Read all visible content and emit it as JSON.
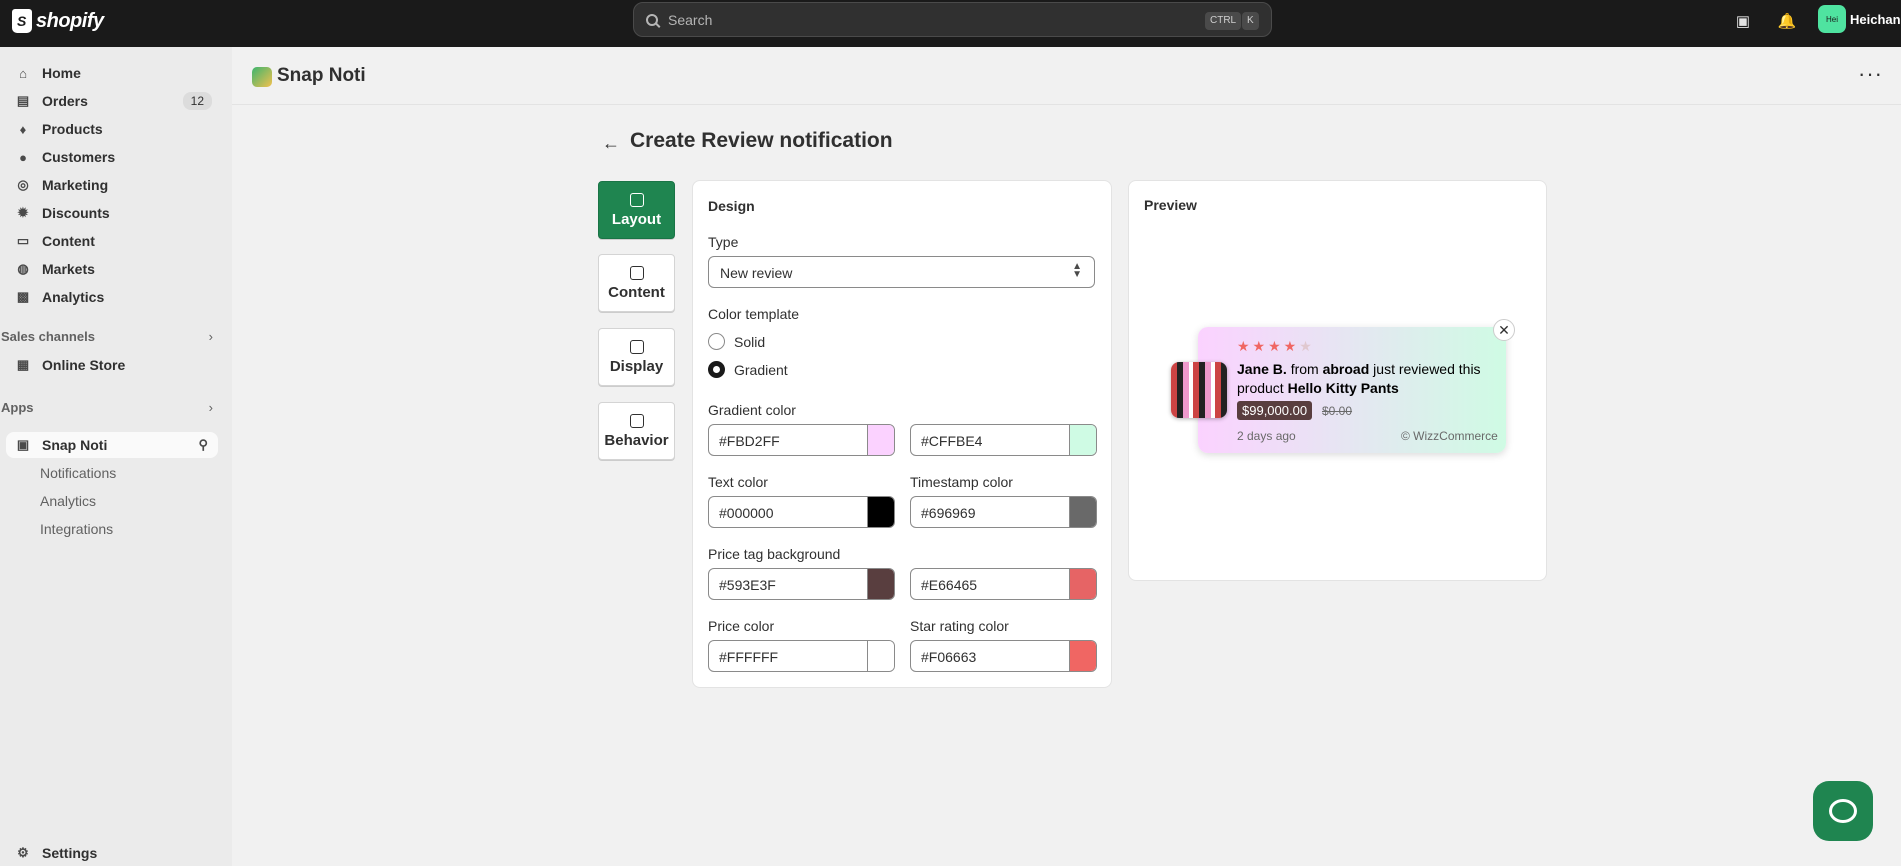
{
  "topbar": {
    "logo_text": "shopify",
    "search_placeholder": "Search",
    "kbd_ctrl": "CTRL",
    "kbd_k": "K",
    "avatar_initials": "Hei",
    "user_name": "Heichan"
  },
  "sidebar": {
    "items": [
      {
        "label": "Home",
        "icon": "home-icon"
      },
      {
        "label": "Orders",
        "icon": "inbox-icon",
        "badge": "12"
      },
      {
        "label": "Products",
        "icon": "tag-icon"
      },
      {
        "label": "Customers",
        "icon": "person-icon"
      },
      {
        "label": "Marketing",
        "icon": "target-icon"
      },
      {
        "label": "Discounts",
        "icon": "discount-icon"
      },
      {
        "label": "Content",
        "icon": "content-icon"
      },
      {
        "label": "Markets",
        "icon": "globe-icon"
      },
      {
        "label": "Analytics",
        "icon": "chart-icon"
      }
    ],
    "sales_channels_label": "Sales channels",
    "online_store_label": "Online Store",
    "apps_label": "Apps",
    "app_name": "Snap Noti",
    "app_subitems": [
      "Notifications",
      "Analytics",
      "Integrations"
    ],
    "settings_label": "Settings"
  },
  "appbar": {
    "title": "Snap Noti"
  },
  "page": {
    "title": "Create Review notification",
    "tabs": [
      "Layout",
      "Content",
      "Display",
      "Behavior"
    ],
    "active_tab": "Layout"
  },
  "design": {
    "heading": "Design",
    "type_label": "Type",
    "type_value": "New review",
    "color_template_label": "Color template",
    "radio_solid": "Solid",
    "radio_gradient": "Gradient",
    "selected_template": "Gradient",
    "gradient_color_label": "Gradient color",
    "gradient_color_1": "#FBD2FF",
    "gradient_color_2": "#CFFBE4",
    "text_color_label": "Text color",
    "text_color": "#000000",
    "timestamp_color_label": "Timestamp color",
    "timestamp_color": "#696969",
    "price_tag_bg_label": "Price tag background",
    "price_tag_bg_1": "#593E3F",
    "price_tag_bg_2": "#E66465",
    "price_color_label": "Price color",
    "price_color": "#FFFFFF",
    "star_rating_color_label": "Star rating color",
    "star_rating_color": "#F06663"
  },
  "preview": {
    "heading": "Preview",
    "name": "Jane B.",
    "from_word": "from",
    "location": "abroad",
    "action_text": "just reviewed this product",
    "product": "Hello Kitty Pants",
    "price": "$99,000.00",
    "old_price": "$0.00",
    "timestamp": "2 days ago",
    "brand": "© WizzCommerce",
    "rating": 4,
    "max_rating": 5
  },
  "colors": {
    "accent_green": "#1F8550",
    "topbar_bg": "#1A1A1A"
  }
}
